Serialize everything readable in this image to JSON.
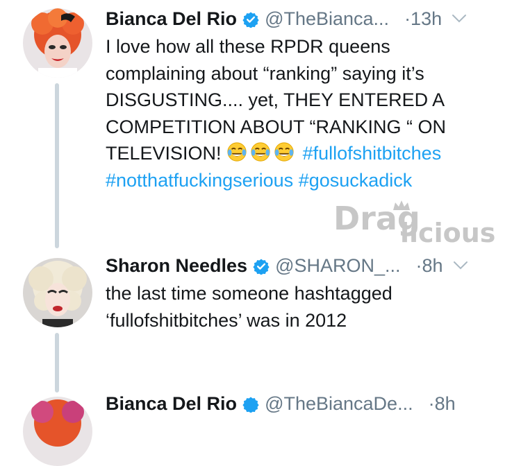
{
  "tweets": [
    {
      "display_name": "Bianca Del Rio",
      "handle": "@TheBianca...",
      "time": "·13h",
      "verified": true,
      "avatar": "drag-queen-red-hair-avatar",
      "text_plain": "I love how all these RPDR queens\ncomplaining about “ranking” saying it’s\nDISGUSTING.... yet, THEY ENTERED A\nCOMPETITION ABOUT “RANKING “ ON\nTELEVISION! ",
      "emojis": [
        "face-with-tears-of-joy-icon",
        "face-with-tears-of-joy-icon",
        "face-with-tears-of-joy-icon"
      ],
      "hashtags": [
        "#fullofshitbitches",
        "#notthatfuckingserious",
        "#gosuckadick"
      ]
    },
    {
      "display_name": "Sharon Needles",
      "handle": "@SHARON_...",
      "time": "·8h",
      "verified": true,
      "avatar": "drag-queen-blonde-hair-avatar",
      "text_plain": "the last time someone hashtagged\n‘fullofshitbitches’ was in 2012"
    },
    {
      "display_name": "Bianca Del Rio",
      "handle": "@TheBiancaDe...",
      "time": "·8h",
      "verified": true,
      "avatar": "drag-queen-red-hair-avatar",
      "partially_visible": true
    }
  ],
  "watermark": {
    "text_top": "Drag",
    "text_bottom": "licious",
    "crown": "crown-icon"
  },
  "colors": {
    "hashtag": "#1da1f2",
    "meta": "#657786",
    "verified": "#1da1f2",
    "thread_line": "#ccd6dd",
    "watermark": "#c7c7c7"
  }
}
